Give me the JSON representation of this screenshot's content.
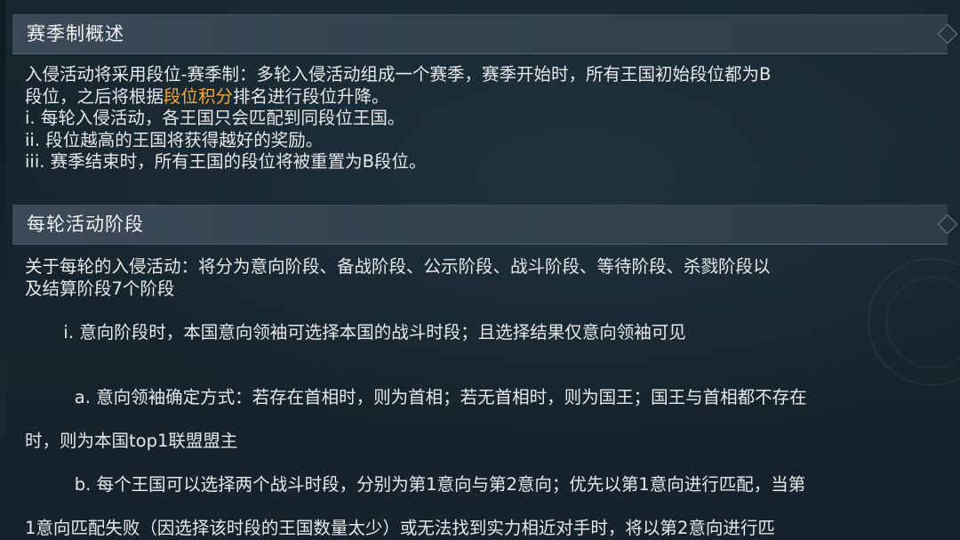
{
  "sections": [
    {
      "title": "赛季制概述",
      "lines": [
        {
          "parts": [
            {
              "text": "入侵活动将采用段位-赛季制：多轮入侵活动组成一个赛季，赛季开始时，所有王国初始段位都为B",
              "highlight": false
            }
          ]
        },
        {
          "parts": [
            {
              "text": "段位，之后将根据",
              "highlight": false
            },
            {
              "text": "段位积分",
              "highlight": true
            },
            {
              "text": "排名进行段位升降。",
              "highlight": false
            }
          ]
        },
        {
          "parts": [
            {
              "text": "i. 每轮入侵活动，各王国只会匹配到同段位王国。",
              "highlight": false
            }
          ]
        },
        {
          "parts": [
            {
              "text": "ii. 段位越高的王国将获得越好的奖励。",
              "highlight": false
            }
          ]
        },
        {
          "parts": [
            {
              "text": "iii. 赛季结束时，所有王国的段位将被重置为B段位。",
              "highlight": false
            }
          ]
        }
      ]
    },
    {
      "title": "每轮活动阶段",
      "lines": [
        {
          "parts": [
            {
              "text": "关于每轮的入侵活动：将分为意向阶段、备战阶段、公示阶段、战斗阶段、等待阶段、杀戮阶段以",
              "highlight": false
            }
          ]
        },
        {
          "parts": [
            {
              "text": "及结算阶段7个阶段",
              "highlight": false
            }
          ]
        },
        {
          "parts": [
            {
              "text": " i. 意向阶段时，本国意向领袖可选择本国的战斗时段；且选择结果仅意向领袖可见",
              "highlight": false
            }
          ]
        },
        {
          "parts": [
            {
              "text": "   a. 意向领袖确定方式：若存在首相时，则为首相；若无首相时，则为国王；国王与首相都不存在",
              "highlight": false
            }
          ]
        },
        {
          "parts": [
            {
              "text": "时，则为本国top1联盟盟主",
              "highlight": false
            }
          ]
        },
        {
          "parts": [
            {
              "text": "   b. 每个王国可以选择两个战斗时段，分别为第1意向与第2意向；优先以第1意向进行匹配，当第",
              "highlight": false
            }
          ]
        },
        {
          "parts": [
            {
              "text": "1意向匹配失败（因选择该时段的王国数量太少）或无法找到实力相近对手时，将以第2意向进行匹",
              "highlight": false
            }
          ]
        }
      ]
    }
  ],
  "colors": {
    "highlight": "#f2a93b",
    "text": "#e5e8ea",
    "header_bg": "#3b4a56",
    "page_bg": "#16232c"
  }
}
